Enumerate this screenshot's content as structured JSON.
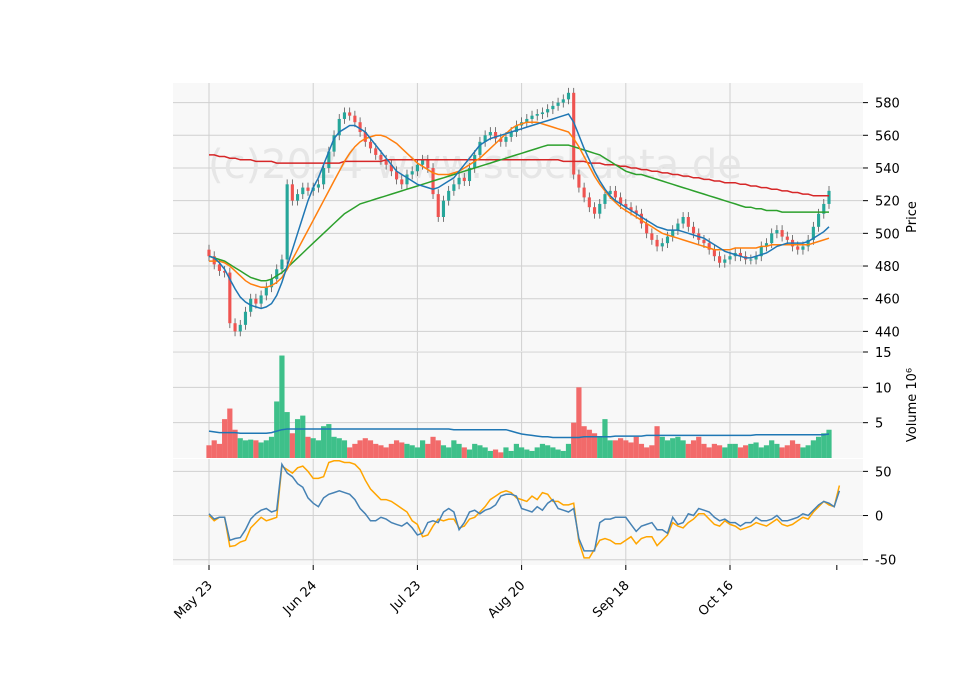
{
  "watermark": "(c)2024 www.stockdata.de",
  "colors": {
    "up": "#26a69a",
    "up_bar": "#3ec08a",
    "down": "#ef5350",
    "down_bar": "#f26a6a",
    "ma_fast": "#1f77b4",
    "ma_mid": "#ff7f0e",
    "ma_slow": "#2ca02c",
    "ma_long": "#d62728",
    "osc_1": "#4682b4",
    "osc_2": "#ffa500",
    "panel_bg": "#f8f8f8",
    "grid": "#d0d0d0"
  },
  "chart_data": {
    "type": "candlestick",
    "x_ticks": [
      "May 23",
      "Jun 24",
      "Jul 23",
      "Aug 20",
      "Sep 18",
      "Oct 16"
    ],
    "x_tick_days": [
      0,
      20,
      40,
      60,
      80,
      100
    ],
    "n_days": 120,
    "price_panel": {
      "ylabel": "Price",
      "ylim": [
        428,
        592
      ],
      "yticks": [
        440,
        460,
        480,
        500,
        520,
        540,
        560,
        580
      ],
      "closes": [
        486,
        481,
        477,
        476,
        445,
        440,
        444,
        452,
        460,
        457,
        462,
        467,
        472,
        478,
        484,
        530,
        520,
        524,
        528,
        526,
        528,
        530,
        540,
        550,
        560,
        570,
        574,
        572,
        568,
        562,
        556,
        552,
        548,
        545,
        542,
        538,
        533,
        530,
        536,
        538,
        542,
        545,
        540,
        524,
        510,
        520,
        526,
        530,
        534,
        532,
        540,
        548,
        556,
        560,
        562,
        558,
        556,
        559,
        562,
        566,
        568,
        570,
        572,
        573,
        574,
        576,
        578,
        580,
        582,
        586,
        536,
        528,
        522,
        516,
        512,
        518,
        524,
        526,
        522,
        518,
        516,
        514,
        512,
        506,
        500,
        496,
        492,
        494,
        498,
        502,
        506,
        510,
        504,
        500,
        496,
        494,
        490,
        486,
        482,
        484,
        486,
        488,
        486,
        484,
        484,
        486,
        492,
        494,
        500,
        502,
        498,
        496,
        492,
        490,
        492,
        496,
        504,
        512,
        518,
        526
      ],
      "ma_fast": [
        486,
        485,
        482,
        478,
        472,
        466,
        461,
        458,
        456,
        455,
        454,
        455,
        457,
        462,
        470,
        480,
        490,
        500,
        510,
        520,
        528,
        534,
        542,
        550,
        558,
        562,
        564,
        566,
        566,
        564,
        562,
        558,
        554,
        550,
        546,
        542,
        538,
        536,
        534,
        532,
        530,
        529,
        528,
        527,
        528,
        530,
        532,
        534,
        538,
        542,
        546,
        550,
        554,
        556,
        558,
        559,
        560,
        561,
        562,
        563,
        564,
        565,
        566,
        567,
        568,
        569,
        570,
        571,
        572,
        573,
        568,
        560,
        552,
        545,
        538,
        532,
        527,
        523,
        520,
        518,
        516,
        514,
        512,
        510,
        508,
        506,
        504,
        503,
        502,
        502,
        502,
        501,
        500,
        499,
        498,
        497,
        495,
        493,
        491,
        489,
        488,
        487,
        486,
        485,
        485,
        486,
        487,
        488,
        490,
        492,
        493,
        494,
        494,
        494,
        494,
        495,
        497,
        499,
        501,
        504
      ],
      "ma_mid": [
        483,
        483,
        483,
        482,
        480,
        477,
        474,
        471,
        469,
        468,
        467,
        467,
        468,
        470,
        473,
        478,
        484,
        490,
        496,
        502,
        508,
        514,
        520,
        526,
        532,
        538,
        544,
        549,
        553,
        556,
        558,
        559,
        560,
        560,
        559,
        557,
        555,
        552,
        549,
        546,
        543,
        541,
        539,
        537,
        536,
        536,
        536,
        537,
        538,
        540,
        542,
        544,
        546,
        549,
        552,
        555,
        558,
        561,
        564,
        566,
        567,
        568,
        568,
        568,
        567,
        566,
        565,
        564,
        563,
        562,
        558,
        553,
        547,
        541,
        535,
        530,
        526,
        522,
        519,
        516,
        514,
        512,
        510,
        508,
        506,
        504,
        502,
        500,
        499,
        498,
        497,
        496,
        495,
        494,
        493,
        492,
        491,
        490,
        490,
        490,
        490,
        491,
        491,
        491,
        491,
        491,
        492,
        492,
        493,
        493,
        493,
        493,
        493,
        493,
        493,
        493,
        494,
        495,
        496,
        497
      ],
      "ma_slow": [
        486,
        485,
        484,
        483,
        481,
        479,
        477,
        475,
        473,
        472,
        471,
        471,
        472,
        474,
        476,
        479,
        482,
        485,
        488,
        491,
        494,
        497,
        500,
        503,
        506,
        509,
        512,
        514,
        516,
        518,
        519,
        520,
        521,
        522,
        523,
        524,
        525,
        526,
        527,
        528,
        529,
        530,
        531,
        532,
        533,
        534,
        535,
        536,
        537,
        538,
        539,
        540,
        541,
        542,
        543,
        544,
        545,
        546,
        547,
        548,
        549,
        550,
        551,
        552,
        553,
        554,
        554,
        554,
        554,
        554,
        553,
        552,
        551,
        550,
        549,
        548,
        546,
        544,
        542,
        540,
        538,
        537,
        536,
        536,
        535,
        534,
        533,
        532,
        531,
        530,
        529,
        528,
        527,
        526,
        525,
        524,
        523,
        522,
        521,
        520,
        519,
        518,
        517,
        516,
        516,
        515,
        515,
        514,
        514,
        514,
        513,
        513,
        513,
        513,
        513,
        513,
        513,
        513,
        513,
        513
      ],
      "ma_long": [
        548,
        548,
        547,
        547,
        546,
        546,
        545,
        545,
        545,
        544,
        544,
        544,
        544,
        543,
        543,
        543,
        543,
        543,
        543,
        543,
        543,
        543,
        543,
        543,
        543,
        543,
        544,
        544,
        544,
        544,
        544,
        544,
        544,
        544,
        545,
        545,
        545,
        545,
        545,
        545,
        545,
        545,
        545,
        545,
        545,
        545,
        545,
        545,
        545,
        545,
        545,
        545,
        545,
        545,
        545,
        545,
        545,
        545,
        545,
        545,
        545,
        545,
        545,
        545,
        545,
        545,
        545,
        545,
        544,
        544,
        544,
        544,
        544,
        543,
        543,
        543,
        542,
        542,
        542,
        541,
        541,
        540,
        540,
        539,
        539,
        538,
        538,
        537,
        537,
        536,
        536,
        535,
        535,
        534,
        534,
        533,
        533,
        532,
        532,
        531,
        531,
        531,
        530,
        530,
        529,
        529,
        528,
        528,
        527,
        527,
        526,
        526,
        525,
        525,
        524,
        524,
        523,
        523,
        523,
        523
      ]
    },
    "volume_panel": {
      "ylabel": "Volume  10⁶",
      "ylim": [
        0,
        15
      ],
      "yticks": [
        5,
        10,
        15
      ],
      "values": [
        1.8,
        2.5,
        2.0,
        5.5,
        7.0,
        4.0,
        2.8,
        2.5,
        2.6,
        2.5,
        2.2,
        2.5,
        3.0,
        8.0,
        14.5,
        6.5,
        3.5,
        5.5,
        6.0,
        3.0,
        2.8,
        2.5,
        4.5,
        4.8,
        3.0,
        2.8,
        2.5,
        1.5,
        2.0,
        2.5,
        2.8,
        2.5,
        2.0,
        1.8,
        1.5,
        2.0,
        2.5,
        2.2,
        2.0,
        1.8,
        1.5,
        2.5,
        2.0,
        3.0,
        2.5,
        1.8,
        1.5,
        2.5,
        2.0,
        1.5,
        1.2,
        2.0,
        1.8,
        1.5,
        1.0,
        1.2,
        0.8,
        1.5,
        1.0,
        2.0,
        1.5,
        1.2,
        1.0,
        1.5,
        2.0,
        1.8,
        1.5,
        1.2,
        1.0,
        2.0,
        5.0,
        10.0,
        4.5,
        4.0,
        3.5,
        3.0,
        5.5,
        2.5,
        2.5,
        2.8,
        2.5,
        2.2,
        3.0,
        2.0,
        1.5,
        1.8,
        4.5,
        3.0,
        2.5,
        2.8,
        3.0,
        2.5,
        2.0,
        2.5,
        3.0,
        2.0,
        1.5,
        2.0,
        1.8,
        1.5,
        2.0,
        2.0,
        1.5,
        1.8,
        2.0,
        2.2,
        1.5,
        1.8,
        2.5,
        2.0,
        1.5,
        1.8,
        2.5,
        2.0,
        1.5,
        1.8,
        2.5,
        3.0,
        3.5,
        4.0
      ],
      "ma": [
        3.8,
        3.7,
        3.6,
        3.6,
        3.6,
        3.6,
        3.5,
        3.5,
        3.5,
        3.5,
        3.5,
        3.5,
        3.6,
        3.8,
        4.0,
        4.1,
        4.1,
        4.1,
        4.1,
        4.1,
        4.1,
        4.1,
        4.1,
        4.1,
        4.1,
        4.1,
        4.1,
        4.1,
        4.1,
        4.1,
        4.1,
        4.1,
        4.1,
        4.1,
        4.1,
        4.1,
        4.1,
        4.1,
        4.1,
        4.1,
        4.1,
        4.1,
        4.1,
        4.1,
        4.1,
        4.1,
        4.1,
        4.0,
        4.0,
        4.0,
        4.0,
        4.0,
        4.0,
        4.0,
        4.0,
        4.0,
        4.0,
        4.0,
        3.8,
        3.6,
        3.4,
        3.3,
        3.2,
        3.1,
        3.0,
        3.0,
        2.9,
        2.9,
        2.9,
        2.9,
        2.9,
        2.9,
        3.0,
        3.0,
        3.0,
        3.0,
        3.0,
        3.0,
        3.1,
        3.1,
        3.1,
        3.1,
        3.1,
        3.1,
        3.2,
        3.2,
        3.2,
        3.2,
        3.2,
        3.2,
        3.2,
        3.2,
        3.2,
        3.2,
        3.2,
        3.2,
        3.2,
        3.2,
        3.2,
        3.2,
        3.2,
        3.2,
        3.2,
        3.2,
        3.2,
        3.3,
        3.3,
        3.3,
        3.3,
        3.3,
        3.3,
        3.3,
        3.3,
        3.3,
        3.3,
        3.3,
        3.3,
        3.3,
        3.3,
        3.4
      ]
    },
    "oscillator_panel": {
      "ylim": [
        -56,
        64
      ],
      "yticks": [
        -50,
        0,
        50
      ],
      "line_1": [
        2,
        -4,
        -2,
        -2,
        -28,
        -26,
        -25,
        -16,
        -4,
        2,
        6,
        8,
        4,
        6,
        58,
        48,
        44,
        36,
        32,
        20,
        14,
        10,
        20,
        24,
        26,
        28,
        26,
        24,
        18,
        8,
        2,
        -6,
        -6,
        -2,
        -4,
        -8,
        -10,
        -12,
        -8,
        -14,
        -22,
        -20,
        -8,
        -6,
        -8,
        4,
        8,
        4,
        -16,
        -8,
        4,
        6,
        2,
        6,
        8,
        12,
        22,
        24,
        24,
        22,
        8,
        6,
        4,
        10,
        6,
        14,
        18,
        8,
        6,
        4,
        8,
        -26,
        -40,
        -40,
        -40,
        -8,
        -4,
        -4,
        -2,
        -2,
        -2,
        -10,
        -18,
        -12,
        -10,
        -8,
        -16,
        -16,
        -20,
        -2,
        -10,
        -8,
        2,
        0,
        8,
        6,
        4,
        -2,
        -6,
        -4,
        -8,
        -8,
        -12,
        -8,
        -8,
        -2,
        -6,
        -6,
        -4,
        0,
        -6,
        -6,
        -4,
        -2,
        2,
        0,
        6,
        12,
        16,
        14,
        10,
        28
      ],
      "line_2": [
        0,
        -6,
        -2,
        -2,
        -35,
        -34,
        -30,
        -28,
        -14,
        -8,
        -2,
        -6,
        -4,
        -2,
        56,
        52,
        48,
        54,
        56,
        50,
        42,
        42,
        44,
        60,
        62,
        62,
        60,
        60,
        58,
        52,
        40,
        30,
        24,
        18,
        18,
        16,
        12,
        8,
        4,
        -6,
        -10,
        -24,
        -22,
        -12,
        -4,
        -6,
        -4,
        -4,
        -14,
        -12,
        -4,
        -2,
        4,
        10,
        18,
        22,
        26,
        28,
        26,
        20,
        18,
        16,
        22,
        18,
        26,
        24,
        16,
        16,
        12,
        12,
        14,
        -30,
        -48,
        -48,
        -38,
        -28,
        -26,
        -28,
        -32,
        -32,
        -28,
        -24,
        -32,
        -26,
        -24,
        -24,
        -34,
        -28,
        -22,
        -8,
        -12,
        -14,
        -8,
        -4,
        2,
        2,
        -4,
        -10,
        -12,
        -6,
        -10,
        -12,
        -16,
        -14,
        -12,
        -8,
        -10,
        -12,
        -8,
        -4,
        -10,
        -12,
        -10,
        -6,
        -2,
        -4,
        4,
        10,
        16,
        12,
        10,
        34
      ]
    }
  }
}
